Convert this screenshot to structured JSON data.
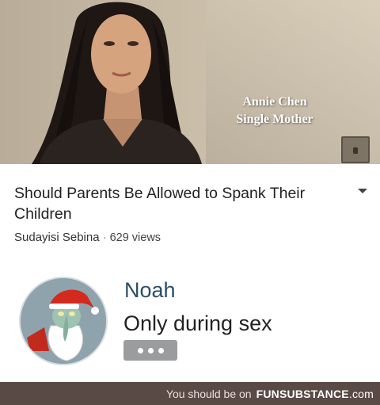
{
  "video": {
    "overlay_name": "Annie Chen",
    "overlay_role": "Single Mother",
    "title": "Should Parents Be Allowed to Spank Their Children",
    "channel": "Sudayisi Sebina",
    "separator": "·",
    "views": "629 views"
  },
  "comment": {
    "author": "Noah",
    "text": "Only during sex"
  },
  "footer": {
    "prefix": "You should be on",
    "brand": "FUNSUBSTANCE",
    "brand_suffix": ".com"
  },
  "icons": {
    "expand": "chevron-down-icon",
    "more": "more-horizontal-icon"
  },
  "colors": {
    "author": "#2b4e66",
    "footer_bg": "#5a4a46",
    "more_button": "#9a9c9e"
  }
}
